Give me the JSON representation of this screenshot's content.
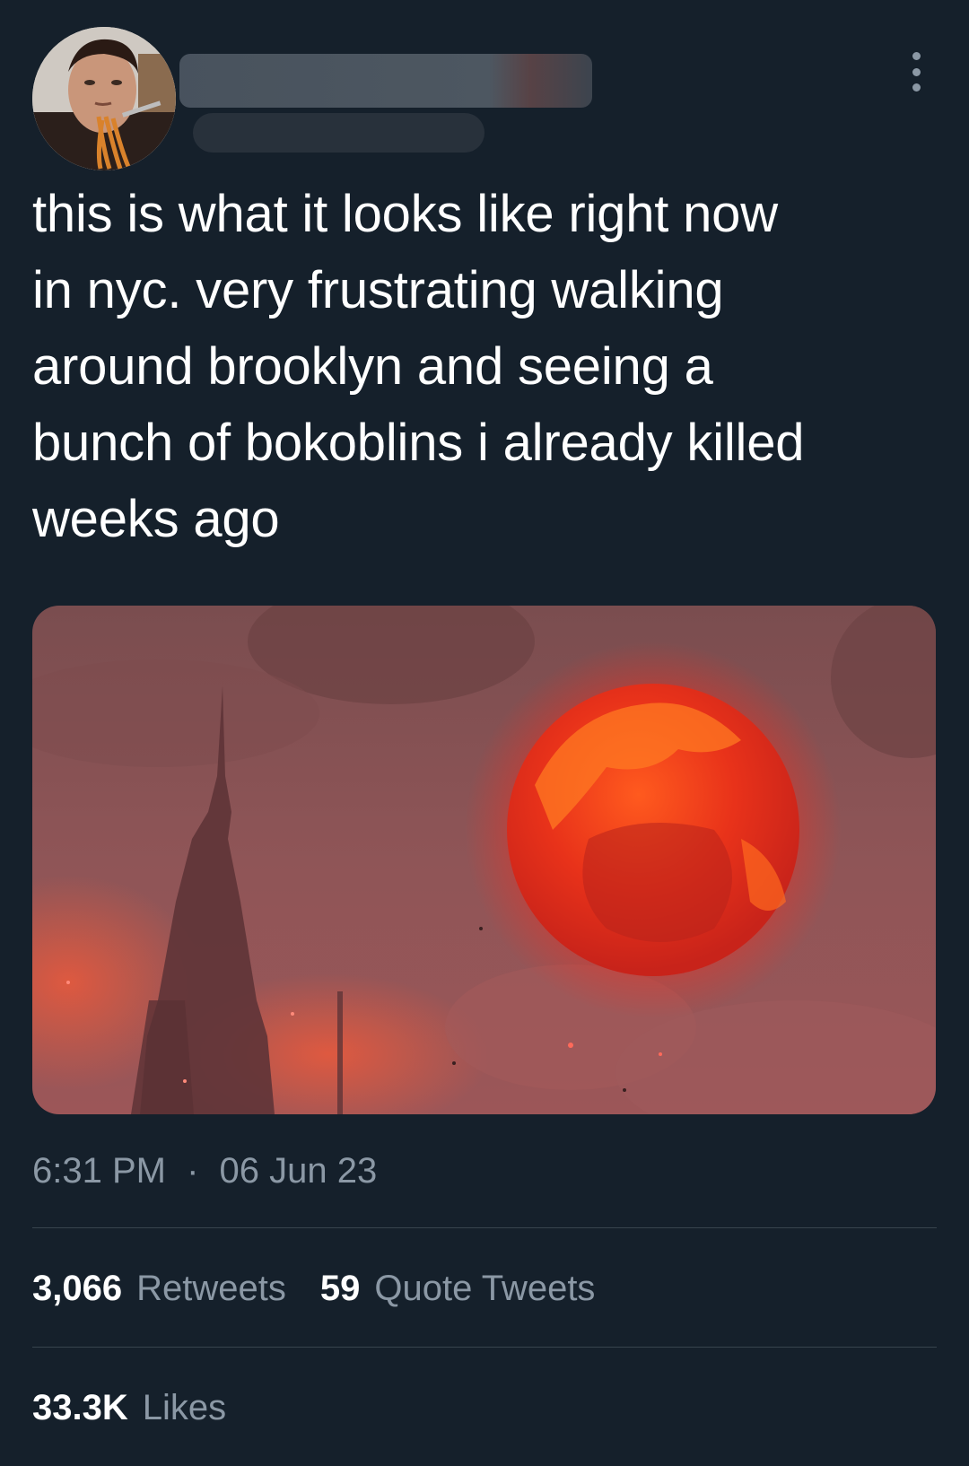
{
  "tweet": {
    "text": "this is what it looks like right now\nin nyc. very frustrating walking\naround brooklyn and seeing a\nbunch of bokoblins i already killed\nweeks ago",
    "time": "6:31 PM",
    "separator": "·",
    "date": "06 Jun 23",
    "media_icon": "blood-moon-image",
    "more_icon": "more-vertical-icon"
  },
  "stats": {
    "retweets_count": "3,066",
    "retweets_label": "Retweets",
    "quotes_count": "59",
    "quotes_label": "Quote Tweets",
    "likes_count": "33.3K",
    "likes_label": "Likes"
  },
  "colors": {
    "background": "#15202b",
    "text_primary": "#ffffff",
    "text_secondary": "#8b98a5",
    "divider": "#38444d",
    "moon": "#e0281b"
  }
}
